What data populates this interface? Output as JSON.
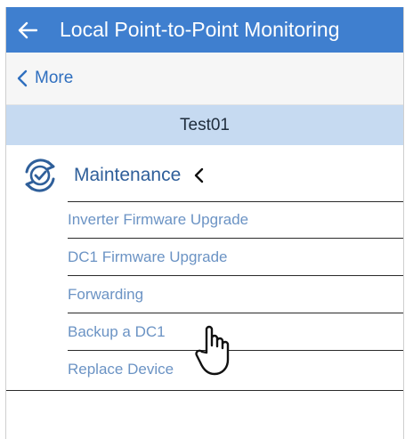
{
  "header": {
    "title": "Local Point-to-Point Monitoring",
    "back_icon": "arrow-left-icon"
  },
  "nav": {
    "more_label": "More",
    "more_icon": "chevron-left-icon"
  },
  "device": {
    "name": "Test01"
  },
  "section": {
    "label": "Maintenance",
    "icon": "sync-check-icon",
    "collapse_icon": "chevron-left-icon"
  },
  "menu": [
    {
      "label": "Inverter Firmware Upgrade"
    },
    {
      "label": "DC1 Firmware Upgrade"
    },
    {
      "label": "Forwarding"
    },
    {
      "label": "Backup a DC1"
    },
    {
      "label": "Replace Device"
    }
  ],
  "colors": {
    "header_bg": "#3f7fcf",
    "device_bar_bg": "#c6daf1",
    "menu_text": "#6b93c4",
    "accent": "#2f6fbf"
  },
  "pointer": {
    "icon": "hand-pointer-icon"
  }
}
